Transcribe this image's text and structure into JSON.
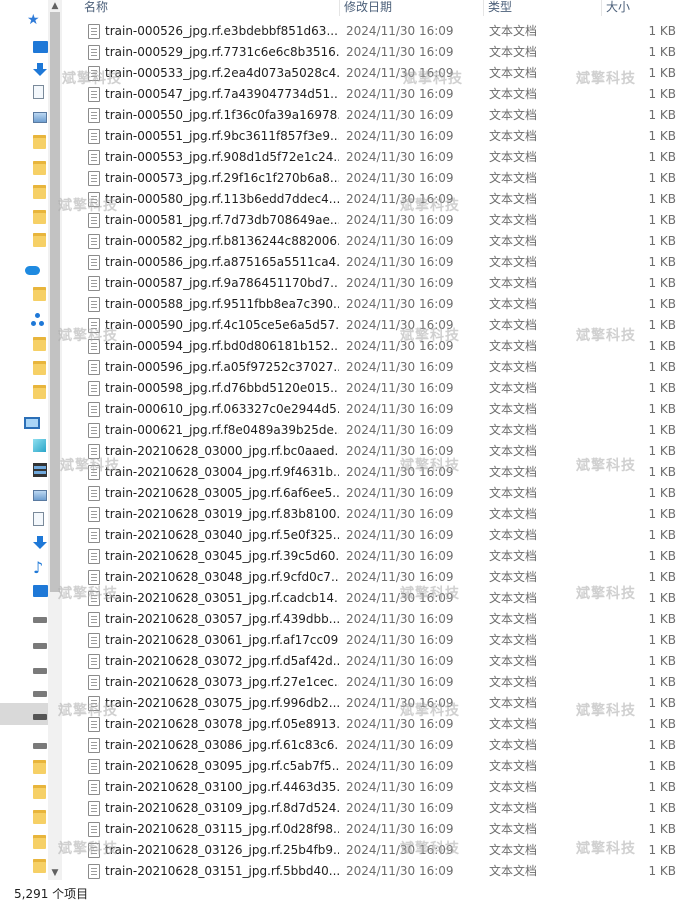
{
  "header": {
    "name_label": "名称",
    "date_label": "修改日期",
    "type_label": "类型",
    "size_label": "大小"
  },
  "nav": {
    "icons": [
      "star-icon",
      "desktop-icon",
      "download-icon",
      "document-icon",
      "picture-icon",
      "folder-icon",
      "folder-icon",
      "folder-icon",
      "folder-icon",
      "folder-icon",
      "cloud-icon",
      "folder-icon",
      "network-icon",
      "folder-icon",
      "folder-icon",
      "folder-icon",
      "this-pc-icon",
      "3d-objects-icon",
      "video-icon",
      "picture-icon",
      "document-icon",
      "download-icon",
      "music-icon",
      "desktop-icon",
      "drive-icon",
      "drive-icon",
      "drive-icon",
      "drive-icon",
      "drive-icon",
      "drive-icon",
      "folder-icon",
      "folder-icon",
      "folder-icon",
      "folder-icon",
      "folder-icon"
    ]
  },
  "files": [
    {
      "name": "train-000526_jpg.rf.e3bdebbf851d63...",
      "date": "2024/11/30 16:09",
      "type": "文本文档",
      "size": "1 KB"
    },
    {
      "name": "train-000529_jpg.rf.7731c6e6c8b3516...",
      "date": "2024/11/30 16:09",
      "type": "文本文档",
      "size": "1 KB"
    },
    {
      "name": "train-000533_jpg.rf.2ea4d073a5028c4...",
      "date": "2024/11/30 16:09",
      "type": "文本文档",
      "size": "1 KB"
    },
    {
      "name": "train-000547_jpg.rf.7a439047734d51...",
      "date": "2024/11/30 16:09",
      "type": "文本文档",
      "size": "1 KB"
    },
    {
      "name": "train-000550_jpg.rf.1f36c0fa39a16978...",
      "date": "2024/11/30 16:09",
      "type": "文本文档",
      "size": "1 KB"
    },
    {
      "name": "train-000551_jpg.rf.9bc3611f857f3e9...",
      "date": "2024/11/30 16:09",
      "type": "文本文档",
      "size": "1 KB"
    },
    {
      "name": "train-000553_jpg.rf.908d1d5f72e1c24...",
      "date": "2024/11/30 16:09",
      "type": "文本文档",
      "size": "1 KB"
    },
    {
      "name": "train-000573_jpg.rf.29f16c1f270b6a8...",
      "date": "2024/11/30 16:09",
      "type": "文本文档",
      "size": "1 KB"
    },
    {
      "name": "train-000580_jpg.rf.113b6edd7ddec4...",
      "date": "2024/11/30 16:09",
      "type": "文本文档",
      "size": "1 KB"
    },
    {
      "name": "train-000581_jpg.rf.7d73db708649ae...",
      "date": "2024/11/30 16:09",
      "type": "文本文档",
      "size": "1 KB"
    },
    {
      "name": "train-000582_jpg.rf.b8136244c882006...",
      "date": "2024/11/30 16:09",
      "type": "文本文档",
      "size": "1 KB"
    },
    {
      "name": "train-000586_jpg.rf.a875165a5511ca4...",
      "date": "2024/11/30 16:09",
      "type": "文本文档",
      "size": "1 KB"
    },
    {
      "name": "train-000587_jpg.rf.9a786451170bd7...",
      "date": "2024/11/30 16:09",
      "type": "文本文档",
      "size": "1 KB"
    },
    {
      "name": "train-000588_jpg.rf.9511fbb8ea7c390...",
      "date": "2024/11/30 16:09",
      "type": "文本文档",
      "size": "1 KB"
    },
    {
      "name": "train-000590_jpg.rf.4c105ce5e6a5d57...",
      "date": "2024/11/30 16:09",
      "type": "文本文档",
      "size": "1 KB"
    },
    {
      "name": "train-000594_jpg.rf.bd0d806181b152...",
      "date": "2024/11/30 16:09",
      "type": "文本文档",
      "size": "1 KB"
    },
    {
      "name": "train-000596_jpg.rf.a05f97252c37027...",
      "date": "2024/11/30 16:09",
      "type": "文本文档",
      "size": "1 KB"
    },
    {
      "name": "train-000598_jpg.rf.d76bbd5120e015...",
      "date": "2024/11/30 16:09",
      "type": "文本文档",
      "size": "1 KB"
    },
    {
      "name": "train-000610_jpg.rf.063327c0e2944d5...",
      "date": "2024/11/30 16:09",
      "type": "文本文档",
      "size": "1 KB"
    },
    {
      "name": "train-000621_jpg.rf.f8e0489a39b25de...",
      "date": "2024/11/30 16:09",
      "type": "文本文档",
      "size": "1 KB"
    },
    {
      "name": "train-20210628_03000_jpg.rf.bc0aaed...",
      "date": "2024/11/30 16:09",
      "type": "文本文档",
      "size": "1 KB"
    },
    {
      "name": "train-20210628_03004_jpg.rf.9f4631b...",
      "date": "2024/11/30 16:09",
      "type": "文本文档",
      "size": "1 KB"
    },
    {
      "name": "train-20210628_03005_jpg.rf.6af6ee5...",
      "date": "2024/11/30 16:09",
      "type": "文本文档",
      "size": "1 KB"
    },
    {
      "name": "train-20210628_03019_jpg.rf.83b8100...",
      "date": "2024/11/30 16:09",
      "type": "文本文档",
      "size": "1 KB"
    },
    {
      "name": "train-20210628_03040_jpg.rf.5e0f325...",
      "date": "2024/11/30 16:09",
      "type": "文本文档",
      "size": "1 KB"
    },
    {
      "name": "train-20210628_03045_jpg.rf.39c5d60...",
      "date": "2024/11/30 16:09",
      "type": "文本文档",
      "size": "1 KB"
    },
    {
      "name": "train-20210628_03048_jpg.rf.9cfd0c7...",
      "date": "2024/11/30 16:09",
      "type": "文本文档",
      "size": "1 KB"
    },
    {
      "name": "train-20210628_03051_jpg.rf.cadcb14...",
      "date": "2024/11/30 16:09",
      "type": "文本文档",
      "size": "1 KB"
    },
    {
      "name": "train-20210628_03057_jpg.rf.439dbb...",
      "date": "2024/11/30 16:09",
      "type": "文本文档",
      "size": "1 KB"
    },
    {
      "name": "train-20210628_03061_jpg.rf.af17cc09...",
      "date": "2024/11/30 16:09",
      "type": "文本文档",
      "size": "1 KB"
    },
    {
      "name": "train-20210628_03072_jpg.rf.d5af42d...",
      "date": "2024/11/30 16:09",
      "type": "文本文档",
      "size": "1 KB"
    },
    {
      "name": "train-20210628_03073_jpg.rf.27e1cec...",
      "date": "2024/11/30 16:09",
      "type": "文本文档",
      "size": "1 KB"
    },
    {
      "name": "train-20210628_03075_jpg.rf.996db2...",
      "date": "2024/11/30 16:09",
      "type": "文本文档",
      "size": "1 KB"
    },
    {
      "name": "train-20210628_03078_jpg.rf.05e8913...",
      "date": "2024/11/30 16:09",
      "type": "文本文档",
      "size": "1 KB"
    },
    {
      "name": "train-20210628_03086_jpg.rf.61c83c6...",
      "date": "2024/11/30 16:09",
      "type": "文本文档",
      "size": "1 KB"
    },
    {
      "name": "train-20210628_03095_jpg.rf.c5ab7f5...",
      "date": "2024/11/30 16:09",
      "type": "文本文档",
      "size": "1 KB"
    },
    {
      "name": "train-20210628_03100_jpg.rf.4463d35...",
      "date": "2024/11/30 16:09",
      "type": "文本文档",
      "size": "1 KB"
    },
    {
      "name": "train-20210628_03109_jpg.rf.8d7d524...",
      "date": "2024/11/30 16:09",
      "type": "文本文档",
      "size": "1 KB"
    },
    {
      "name": "train-20210628_03115_jpg.rf.0d28f98...",
      "date": "2024/11/30 16:09",
      "type": "文本文档",
      "size": "1 KB"
    },
    {
      "name": "train-20210628_03126_jpg.rf.25b4fb9...",
      "date": "2024/11/30 16:09",
      "type": "文本文档",
      "size": "1 KB"
    },
    {
      "name": "train-20210628_03151_jpg.rf.5bbd40...",
      "date": "2024/11/30 16:09",
      "type": "文本文档",
      "size": "1 KB"
    }
  ],
  "watermark": {
    "text": "斌擎科技"
  },
  "status": {
    "item_count": "5,291 个项目"
  },
  "colors": {
    "header_text": "#4c607a",
    "meta_text": "#6d6d6d",
    "selected_nav": "#d9d9d9"
  }
}
